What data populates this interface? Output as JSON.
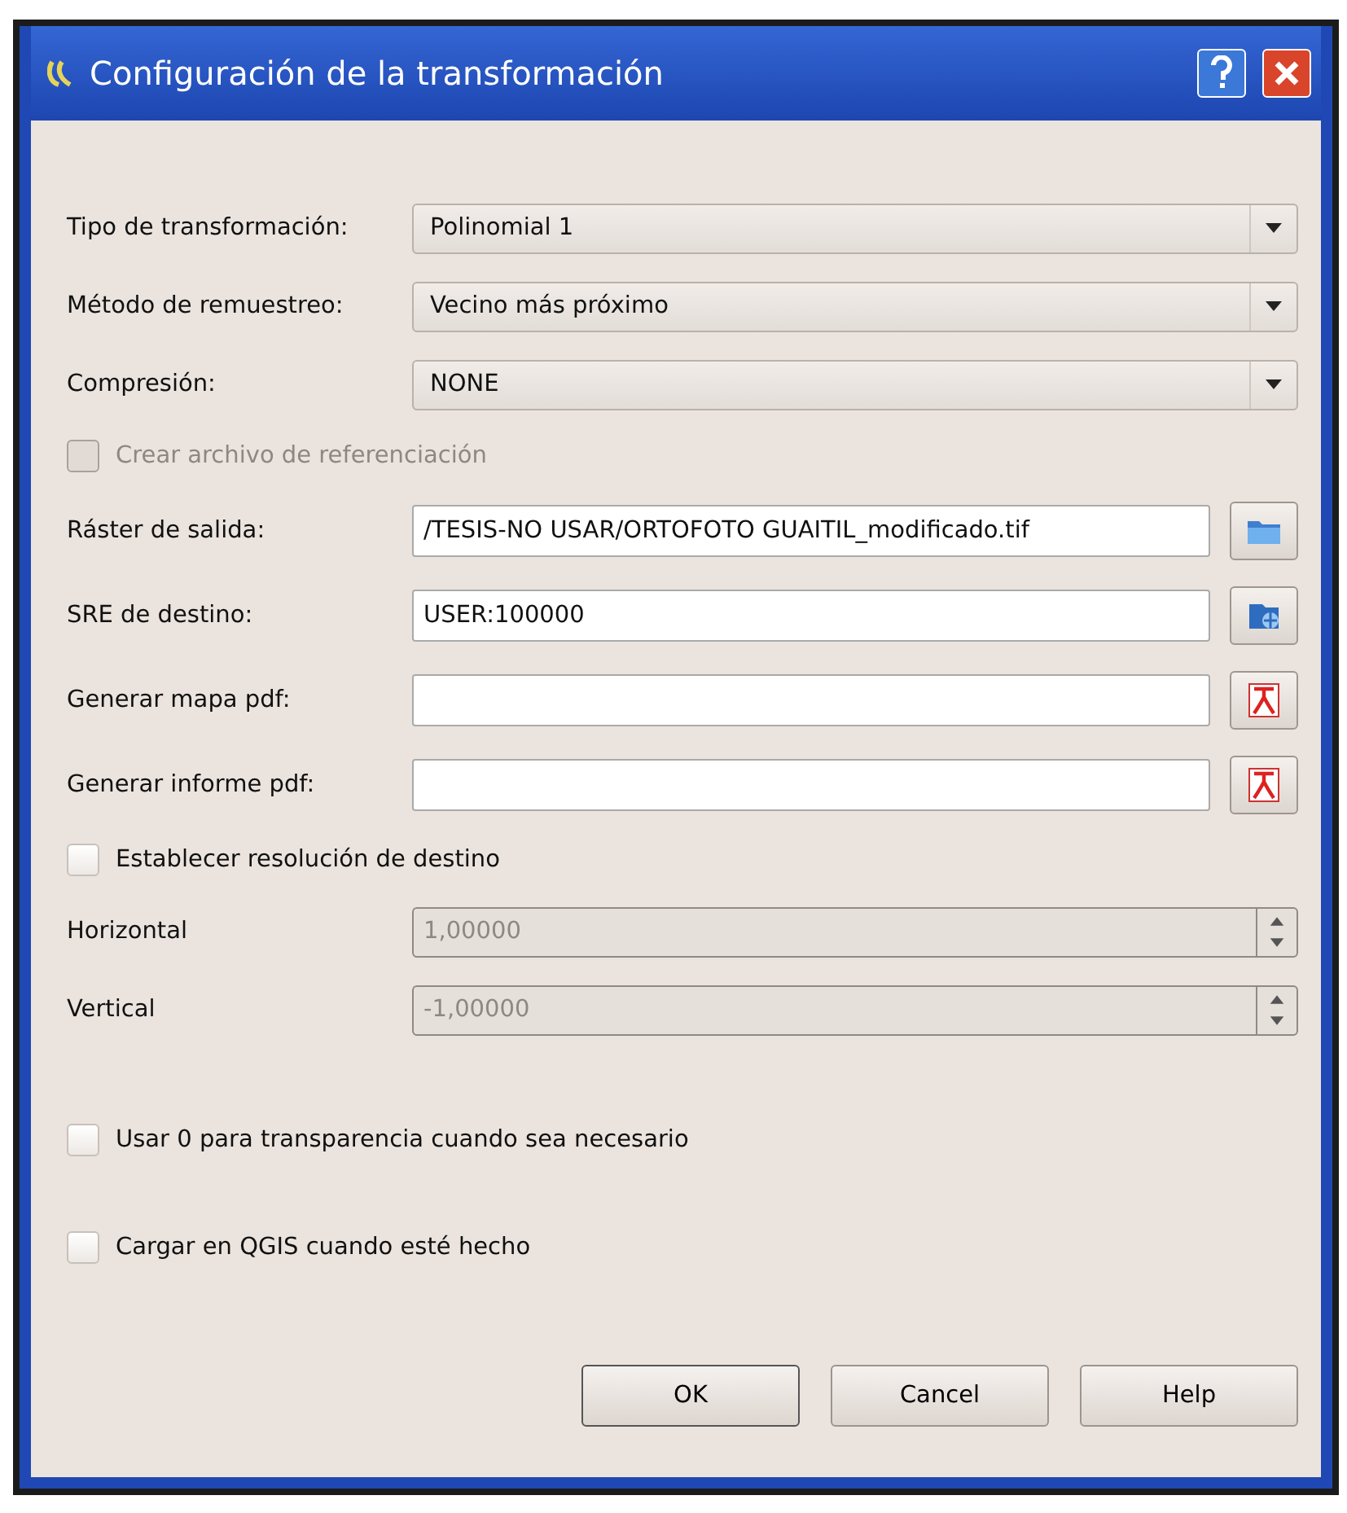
{
  "window": {
    "title": "Configuración de la transformación"
  },
  "fields": [
    {
      "kind": "combo",
      "label": "Tipo de transformación:",
      "value": "Polinomial 1"
    },
    {
      "kind": "combo",
      "label": "Método de remuestreo:",
      "value": "Vecino más próximo"
    },
    {
      "kind": "combo",
      "label": "Compresión:",
      "value": "NONE"
    },
    {
      "kind": "checkbox",
      "label": "Crear archivo de referenciación",
      "checked": false,
      "disabled": true
    },
    {
      "kind": "output",
      "label": "Ráster de salida:",
      "value": "/TESIS-NO USAR/ORTOFOTO GUAITIL_modificado.tif"
    },
    {
      "kind": "crs",
      "label": "SRE de destino:",
      "value": "USER:100000"
    },
    {
      "kind": "pdf",
      "label": "Generar mapa pdf:"
    },
    {
      "kind": "pdf",
      "label": "Generar informe pdf:"
    },
    {
      "kind": "checkbox",
      "label": "Establecer resolución de destino",
      "checked": false,
      "disabled": false
    },
    {
      "kind": "spin",
      "label": "Horizontal",
      "value": "1,00000",
      "disabled": true
    },
    {
      "kind": "spin",
      "label": "Vertical",
      "value": "-1,00000",
      "disabled": true
    },
    {
      "kind": "checkbox",
      "label": "Usar 0 para transparencia cuando sea necesario",
      "checked": false,
      "disabled": false
    },
    {
      "kind": "checkbox",
      "label": "Cargar en QGIS cuando esté hecho",
      "checked": false,
      "disabled": false
    }
  ],
  "buttons": [
    "OK",
    "Cancel",
    "Help"
  ]
}
